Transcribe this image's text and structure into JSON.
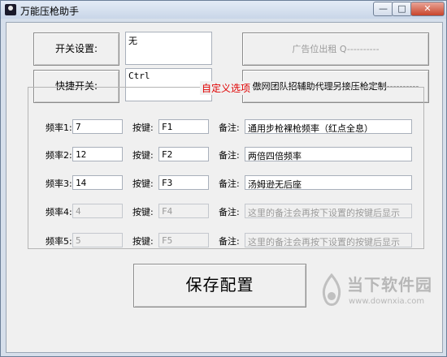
{
  "window": {
    "title": "万能压枪助手",
    "min_glyph": "—",
    "max_glyph": "□",
    "close_glyph": "✕"
  },
  "top": {
    "switch_label": "开关设置:",
    "switch_value": "无",
    "hotkey_label": "快捷开关:",
    "hotkey_value": "Ctrl",
    "ad_button": "广告位出租 Q----------",
    "custom_button": "傲网团队招辅助代理另接压枪定制----------"
  },
  "custom": {
    "title": "自定义选项",
    "key_label": "按键:",
    "note_label": "备注:",
    "rows": [
      {
        "freq_label": "频率1:",
        "freq": "7",
        "key": "F1",
        "note": "通用步枪裸枪频率（红点全息）"
      },
      {
        "freq_label": "频率2:",
        "freq": "12",
        "key": "F2",
        "note": "两倍四倍频率"
      },
      {
        "freq_label": "频率3:",
        "freq": "14",
        "key": "F3",
        "note": "汤姆逊无后座"
      },
      {
        "freq_label": "频率4:",
        "freq": "4",
        "key": "F4",
        "note": "这里的备注会再按下设置的按键后显示"
      },
      {
        "freq_label": "频率5:",
        "freq": "5",
        "key": "F5",
        "note": "这里的备注会再按下设置的按键后显示"
      }
    ]
  },
  "save_label": "保存配置",
  "watermark": {
    "text": "当下软件园",
    "url": "www.downxia.com"
  }
}
